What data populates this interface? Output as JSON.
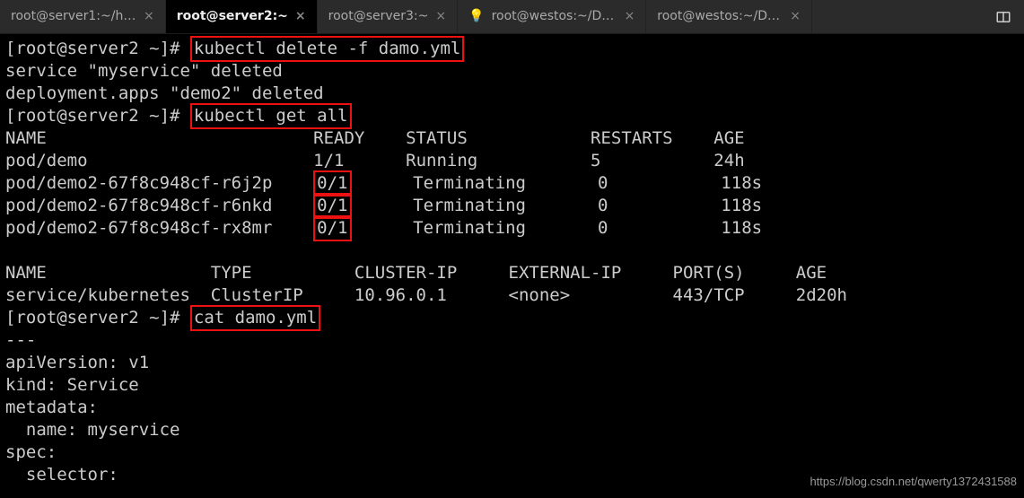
{
  "tabs": {
    "t0": "root@server1:~/harb…",
    "t1": "root@server2:~",
    "t2": "root@server3:~",
    "t3": "root@westos:~/Desk…",
    "t4": "root@westos:~/Desk…"
  },
  "term": {
    "prompt": "[root@server2 ~]# ",
    "cmd_delete": "kubectl delete -f damo.yml",
    "out_svc_deleted": "service \"myservice\" deleted",
    "out_dep_deleted": "deployment.apps \"demo2\" deleted",
    "cmd_get_all": "kubectl get all",
    "pods_header": {
      "name": "NAME",
      "ready": "READY",
      "status": "STATUS",
      "restarts": "RESTARTS",
      "age": "AGE"
    },
    "pods": [
      {
        "name": "pod/demo",
        "ready": "1/1",
        "status": "Running",
        "restarts": "5",
        "age": "24h",
        "hl": false
      },
      {
        "name": "pod/demo2-67f8c948cf-r6j2p",
        "ready": "0/1",
        "status": "Terminating",
        "restarts": "0",
        "age": "118s",
        "hl": true
      },
      {
        "name": "pod/demo2-67f8c948cf-r6nkd",
        "ready": "0/1",
        "status": "Terminating",
        "restarts": "0",
        "age": "118s",
        "hl": true
      },
      {
        "name": "pod/demo2-67f8c948cf-rx8mr",
        "ready": "0/1",
        "status": "Terminating",
        "restarts": "0",
        "age": "118s",
        "hl": true
      }
    ],
    "svc_header": {
      "name": "NAME",
      "type": "TYPE",
      "cip": "CLUSTER-IP",
      "eip": "EXTERNAL-IP",
      "ports": "PORT(S)",
      "age": "AGE"
    },
    "svc_row": {
      "name": "service/kubernetes",
      "type": "ClusterIP",
      "cip": "10.96.0.1",
      "eip": "<none>",
      "ports": "443/TCP",
      "age": "2d20h"
    },
    "cmd_cat": "cat damo.yml",
    "yaml": [
      "---",
      "apiVersion: v1",
      "kind: Service",
      "metadata:",
      "  name: myservice",
      "spec:",
      "  selector:"
    ]
  },
  "watermark": "https://blog.csdn.net/qwerty1372431588"
}
